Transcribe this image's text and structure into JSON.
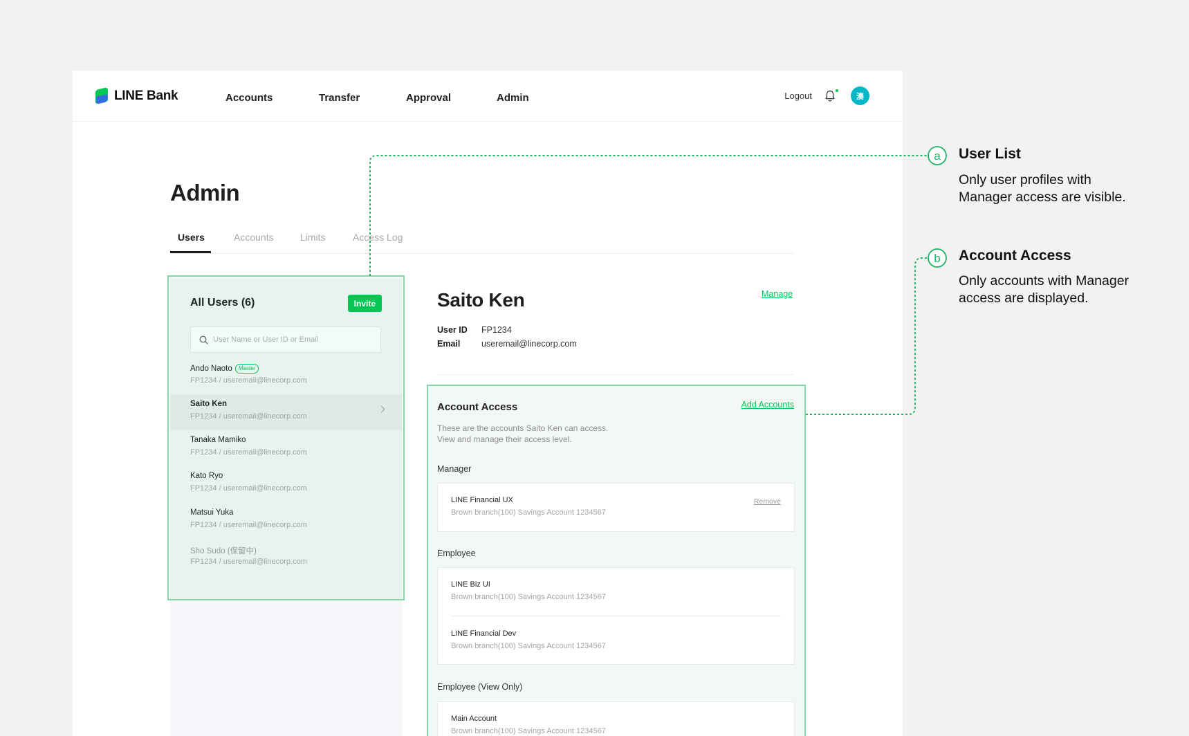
{
  "header": {
    "logo_text": "LINE Bank",
    "nav": [
      "Accounts",
      "Transfer",
      "Approval",
      "Admin"
    ],
    "logout_label": "Logout",
    "avatar_initial": "湊"
  },
  "page": {
    "title": "Admin",
    "tabs": [
      "Users",
      "Accounts",
      "Limits",
      "Access Log"
    ],
    "active_tab": "Users"
  },
  "user_list": {
    "title": "All Users (6)",
    "invite_label": "Invite",
    "search_placeholder": "User Name or User ID or Email",
    "users": [
      {
        "name": "Ando Naoto",
        "badge": "Master",
        "sub": "FP1234 / useremail@linecorp.com"
      },
      {
        "name": "Saito Ken",
        "sub": "FP1234 / useremail@linecorp.com",
        "selected": true
      },
      {
        "name": "Tanaka Mamiko",
        "sub": "FP1234 / useremail@linecorp.com"
      },
      {
        "name": "Kato Ryo",
        "sub": "FP1234 / useremail@linecorp.com"
      },
      {
        "name": "Matsui Yuka",
        "sub": "FP1234 / useremail@linecorp.com"
      },
      {
        "name": "Sho Sudo (保留中)",
        "sub": "FP1234 / useremail@linecorp.com",
        "muted": true
      }
    ]
  },
  "detail": {
    "name": "Saito Ken",
    "manage_label": "Manage",
    "user_id_label": "User ID",
    "user_id": "FP1234",
    "email_label": "Email",
    "email": "useremail@linecorp.com"
  },
  "account_access": {
    "title": "Account Access",
    "add_label": "Add Accounts",
    "desc_line1": "These are the accounts Saito Ken can access.",
    "desc_line2": "View and manage their access level.",
    "manager_label": "Manager",
    "manager_accounts": [
      {
        "name": "LINE Financial UX",
        "desc": "Brown branch(100) Savings Account 1234567",
        "action": "Remove"
      }
    ],
    "employee_label": "Employee",
    "employee_accounts": [
      {
        "name": "LINE Biz UI",
        "desc": "Brown branch(100) Savings Account 1234567"
      },
      {
        "name": "LINE Financial Dev",
        "desc": "Brown branch(100) Savings Account 1234567"
      }
    ],
    "view_only_label": "Employee (View Only)",
    "view_only_accounts": [
      {
        "name": "Main Account",
        "desc": "Brown branch(100) Savings Account 1234567"
      }
    ]
  },
  "annotations": {
    "a": {
      "marker": "a",
      "title": "User List",
      "line1": "Only user profiles with",
      "line2": "Manager access are visible."
    },
    "b": {
      "marker": "b",
      "title": "Account Access",
      "line1": "Only accounts with Manager",
      "line2": "access are displayed."
    }
  },
  "colors": {
    "brand_green": "#06c755",
    "highlight": "#82d8a6",
    "avatar": "#06b8c7"
  }
}
